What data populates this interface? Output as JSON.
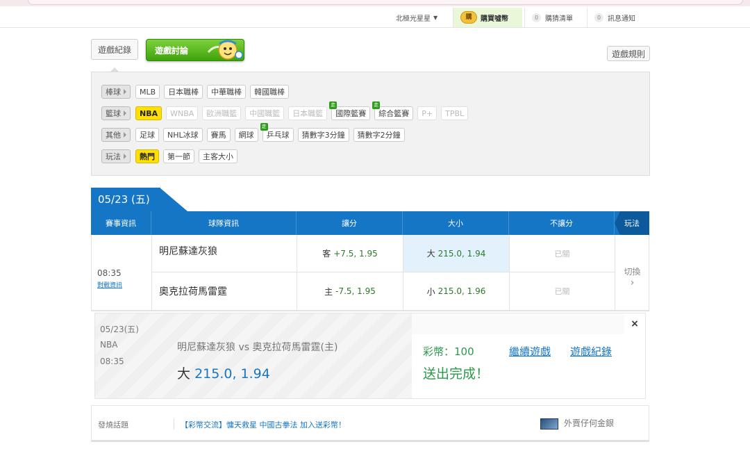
{
  "topbar": {
    "star_label": "北極光星星",
    "buy_coin_badge": "購",
    "buy_label": "購買噓幣",
    "cart_count": "0",
    "cart_label": "購猜清單",
    "notice_count": "0",
    "notice_label": "訊息通知"
  },
  "tabs": {
    "records": "遊戲紀錄",
    "discuss": "遊戲討論",
    "rules": "遊戲規則"
  },
  "filters": {
    "rows": [
      {
        "label": "棒球",
        "chips": [
          "MLB",
          "日本職棒",
          "中華職棒",
          "韓國職棒"
        ]
      },
      {
        "label": "籃球",
        "chips": [
          "NBA",
          "WNBA",
          "歐洲職籃",
          "中國職籃",
          "日本職籃",
          "國際籃賽",
          "綜合籃賽",
          "P+",
          "TPBL"
        ]
      },
      {
        "label": "其他",
        "chips": [
          "足球",
          "NHL冰球",
          "賽馬",
          "網球",
          "乒乓球",
          "猜數字3分鐘",
          "猜數字2分鐘"
        ]
      },
      {
        "label": "玩法",
        "chips": [
          "熱門",
          "第一節",
          "主客大小"
        ]
      }
    ],
    "live_badge": "走"
  },
  "date_tab": "05/23 (五)",
  "table": {
    "headers": [
      "賽事資訊",
      "球隊資訊",
      "讓分",
      "大小",
      "不讓分",
      "玩法"
    ],
    "time": "08:35",
    "vs_info": "對戰資訊",
    "switch": "切換",
    "switch_arrow": "›",
    "closed": "已關",
    "rows": [
      {
        "team": "明尼蘇達灰狼",
        "spread_side": "客",
        "spread_line": "+7.5,",
        "spread_odds": "1.95",
        "total_side": "大",
        "total_line": "215.0,",
        "total_odds": "1.94"
      },
      {
        "team": "奧克拉荷馬雷霆",
        "spread_side": "主",
        "spread_line": "-7.5,",
        "spread_odds": "1.95",
        "total_side": "小",
        "total_line": "215.0,",
        "total_odds": "1.96"
      }
    ]
  },
  "confirm": {
    "date": "05/23(五)",
    "league": "NBA",
    "time": "08:35",
    "matchup": "明尼蘇達灰狼 vs 奧克拉荷馬雷霆(主)",
    "pick_side": "大",
    "pick_value": "215.0, 1.94",
    "coins": "彩幣：100",
    "continue": "繼續遊戲",
    "records": "遊戲紀錄",
    "done": "送出完成！",
    "close": "×"
  },
  "hot": {
    "label": "發燒話題",
    "topic": "【彩幣交流】慵天救星 中國古拳法 加入送彩幣！",
    "ad": "外賣仔何金銀"
  }
}
